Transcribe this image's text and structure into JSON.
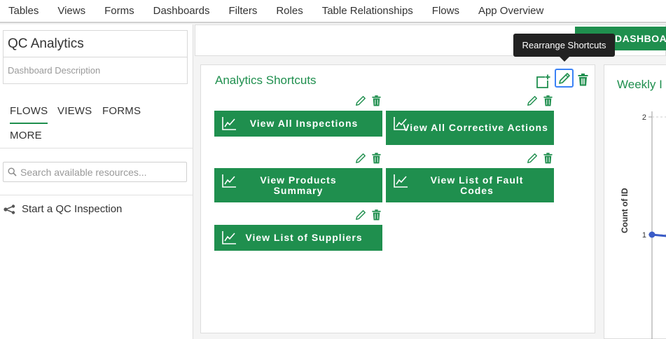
{
  "nav": {
    "items": [
      "Tables",
      "Views",
      "Forms",
      "Dashboards",
      "Filters",
      "Roles",
      "Table Relationships",
      "Flows",
      "App Overview"
    ]
  },
  "sidebar": {
    "title": "QC Analytics",
    "description_placeholder": "Dashboard Description",
    "tabs": [
      "FLOWS",
      "VIEWS",
      "FORMS",
      "MORE"
    ],
    "active_tab": "FLOWS",
    "search_placeholder": "Search available resources...",
    "flows": [
      "Start a QC Inspection"
    ]
  },
  "header": {
    "button_label": "DASHBOA",
    "tooltip": "Rearrange Shortcuts"
  },
  "panel": {
    "title": "Analytics Shortcuts",
    "shortcuts": [
      "View All Inspections",
      "View All Corrective Actions",
      "View Products Summary",
      "View List of Fault Codes",
      "View List of Suppliers"
    ]
  },
  "chart": {
    "title": "Weekly I",
    "ylabel": "Count of ID",
    "ticks": [
      "2",
      "1"
    ]
  },
  "colors": {
    "accent": "#1f8f4e",
    "focus": "#3b82f6",
    "series": "#3a5bc7"
  },
  "chart_data": {
    "type": "line",
    "title": "Weekly I",
    "ylabel": "Count of ID",
    "ylim": [
      0,
      2
    ],
    "yticks": [
      1,
      2
    ],
    "series": [
      {
        "values": [
          1,
          1
        ]
      }
    ]
  }
}
